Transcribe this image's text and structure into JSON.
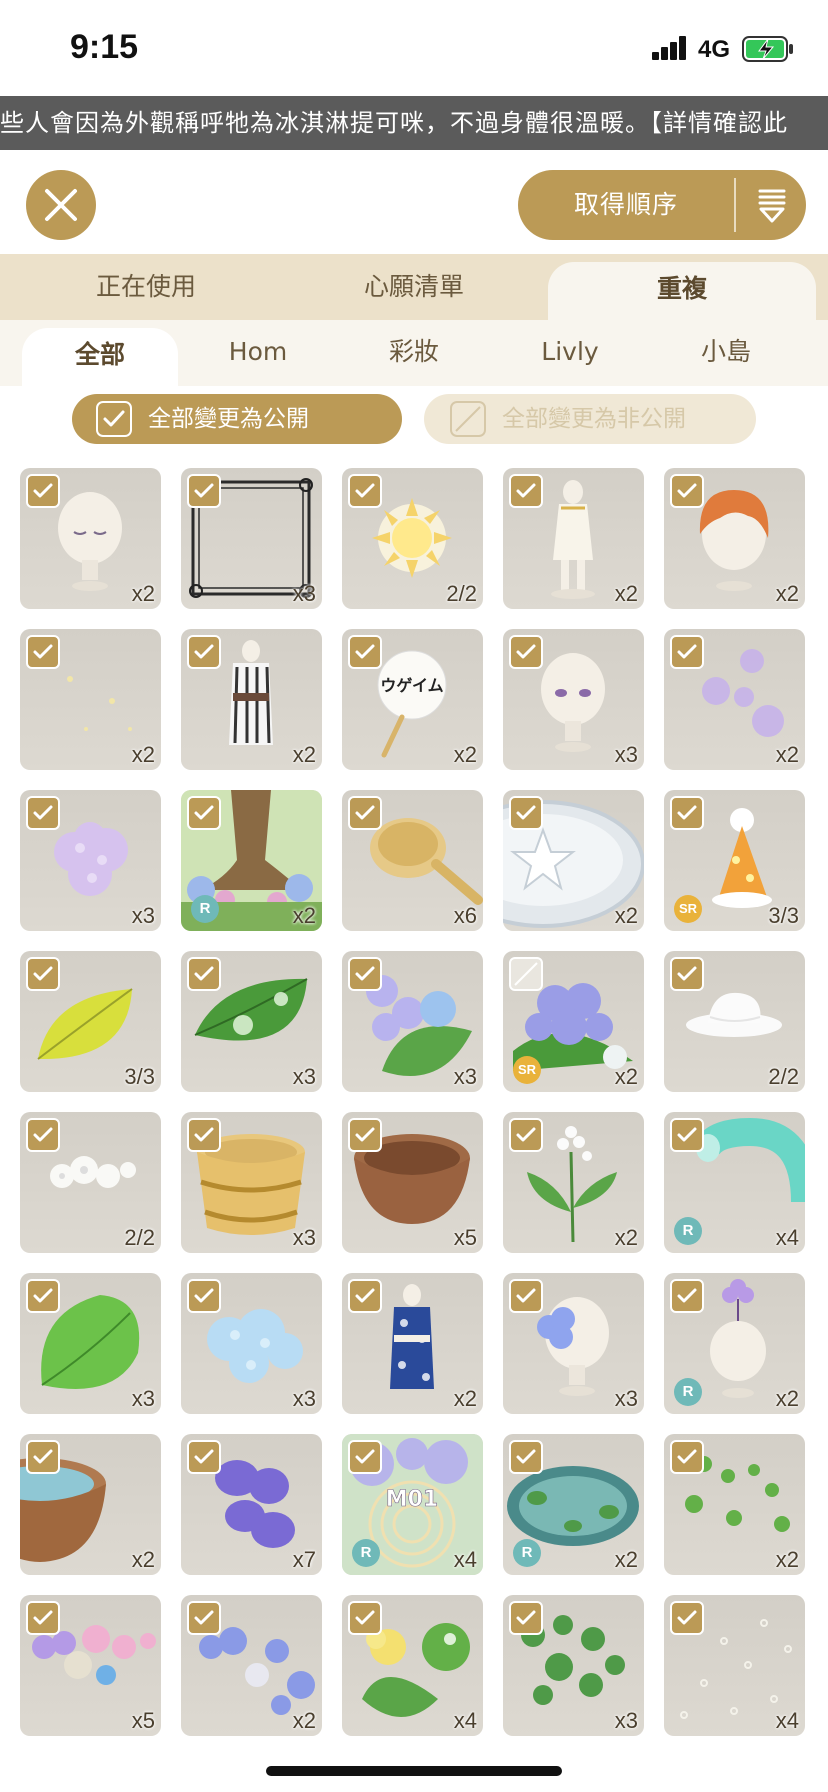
{
  "status_bar": {
    "time": "9:15",
    "network": "4G"
  },
  "ticker": {
    "text": "些人會因為外觀稱呼牠為冰淇淋提可咪，不過身體很溫暖。【詳情確認此"
  },
  "header": {
    "sort_label": "取得順序"
  },
  "main_tabs": [
    {
      "label": "正在使用",
      "active": false
    },
    {
      "label": "心願清單",
      "active": false
    },
    {
      "label": "重複",
      "active": true
    }
  ],
  "sub_tabs": [
    {
      "label": "全部",
      "active": true
    },
    {
      "label": "Hom",
      "active": false
    },
    {
      "label": "彩妝",
      "active": false
    },
    {
      "label": "Livly",
      "active": false
    },
    {
      "label": "小島",
      "active": false
    }
  ],
  "visibility": {
    "public_all": "全部變更為公開",
    "private_all": "全部變更為非公開"
  },
  "colors": {
    "accent": "#bb9a56",
    "tab_bar": "#ece1ca",
    "tile": "#d6d2ca",
    "rarity_r": "#6fb9b8",
    "rarity_sr": "#e9b23a"
  },
  "items": [
    {
      "icon": "head-closed-eyes",
      "count": "x2",
      "checked": true,
      "rarity": ""
    },
    {
      "icon": "ornate-frame",
      "count": "x3",
      "checked": true,
      "rarity": ""
    },
    {
      "icon": "sun",
      "count": "2/2",
      "checked": true,
      "rarity": ""
    },
    {
      "icon": "white-dress",
      "count": "x2",
      "checked": true,
      "rarity": ""
    },
    {
      "icon": "orange-hair",
      "count": "x2",
      "checked": true,
      "rarity": ""
    },
    {
      "icon": "sparkles",
      "count": "x2",
      "checked": true,
      "rarity": ""
    },
    {
      "icon": "striped-yukata",
      "count": "x2",
      "checked": true,
      "rarity": ""
    },
    {
      "icon": "uchiwa-fan",
      "count": "x2",
      "checked": true,
      "rarity": "",
      "text": "ウゲイム"
    },
    {
      "icon": "head-purple-eyes",
      "count": "x3",
      "checked": true,
      "rarity": ""
    },
    {
      "icon": "purple-petals",
      "count": "x2",
      "checked": true,
      "rarity": ""
    },
    {
      "icon": "lilac-hydrangea",
      "count": "x3",
      "checked": true,
      "rarity": ""
    },
    {
      "icon": "tree-with-flowers",
      "count": "x2",
      "checked": true,
      "rarity": "R"
    },
    {
      "icon": "wooden-ladle",
      "count": "x6",
      "checked": true,
      "rarity": ""
    },
    {
      "icon": "silver-platform",
      "count": "x2",
      "checked": true,
      "rarity": ""
    },
    {
      "icon": "party-hat",
      "count": "3/3",
      "checked": true,
      "rarity": "SR"
    },
    {
      "icon": "yellow-leaf",
      "count": "3/3",
      "checked": true,
      "rarity": ""
    },
    {
      "icon": "green-leaf-drops",
      "count": "x3",
      "checked": true,
      "rarity": ""
    },
    {
      "icon": "hydrangea-leaf",
      "count": "x3",
      "checked": true,
      "rarity": ""
    },
    {
      "icon": "hydrangea-drop",
      "count": "x2",
      "checked": false,
      "rarity": "SR"
    },
    {
      "icon": "white-hat",
      "count": "2/2",
      "checked": true,
      "rarity": ""
    },
    {
      "icon": "white-roses",
      "count": "2/2",
      "checked": true,
      "rarity": ""
    },
    {
      "icon": "wooden-tub",
      "count": "x3",
      "checked": true,
      "rarity": ""
    },
    {
      "icon": "clay-bowl",
      "count": "x5",
      "checked": true,
      "rarity": ""
    },
    {
      "icon": "white-flower-plant",
      "count": "x2",
      "checked": true,
      "rarity": ""
    },
    {
      "icon": "water-pipe",
      "count": "x4",
      "checked": true,
      "rarity": "R"
    },
    {
      "icon": "big-leaf",
      "count": "x3",
      "checked": true,
      "rarity": ""
    },
    {
      "icon": "blue-hydrangea",
      "count": "x3",
      "checked": true,
      "rarity": ""
    },
    {
      "icon": "blue-yukata",
      "count": "x2",
      "checked": true,
      "rarity": ""
    },
    {
      "icon": "head-blue-flower",
      "count": "x3",
      "checked": true,
      "rarity": ""
    },
    {
      "icon": "head-purple-flower",
      "count": "x2",
      "checked": true,
      "rarity": "R"
    },
    {
      "icon": "water-basin",
      "count": "x2",
      "checked": true,
      "rarity": ""
    },
    {
      "icon": "violet-petals",
      "count": "x7",
      "checked": true,
      "rarity": ""
    },
    {
      "icon": "music-tile",
      "count": "x4",
      "checked": true,
      "rarity": "R",
      "text": "M01"
    },
    {
      "icon": "pond",
      "count": "x2",
      "checked": true,
      "rarity": "R"
    },
    {
      "icon": "lily-pads",
      "count": "x2",
      "checked": true,
      "rarity": ""
    },
    {
      "icon": "pink-hydrangea-garland",
      "count": "x5",
      "checked": true,
      "rarity": ""
    },
    {
      "icon": "blue-hydrangea-garland",
      "count": "x2",
      "checked": true,
      "rarity": ""
    },
    {
      "icon": "yellow-flower-pads",
      "count": "x4",
      "checked": true,
      "rarity": ""
    },
    {
      "icon": "green-vines",
      "count": "x3",
      "checked": true,
      "rarity": ""
    },
    {
      "icon": "bubbles",
      "count": "x4",
      "checked": true,
      "rarity": ""
    }
  ]
}
